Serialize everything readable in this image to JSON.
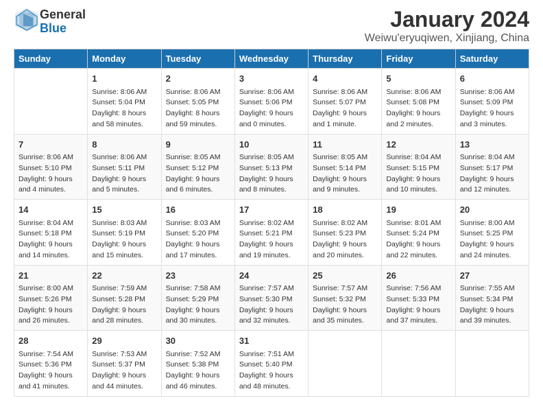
{
  "logo": {
    "general": "General",
    "blue": "Blue"
  },
  "title": "January 2024",
  "subtitle": "Weiwu'eryuqiwen, Xinjiang, China",
  "headers": [
    "Sunday",
    "Monday",
    "Tuesday",
    "Wednesday",
    "Thursday",
    "Friday",
    "Saturday"
  ],
  "weeks": [
    [
      {
        "day": "",
        "lines": []
      },
      {
        "day": "1",
        "lines": [
          "Sunrise: 8:06 AM",
          "Sunset: 5:04 PM",
          "Daylight: 8 hours",
          "and 58 minutes."
        ]
      },
      {
        "day": "2",
        "lines": [
          "Sunrise: 8:06 AM",
          "Sunset: 5:05 PM",
          "Daylight: 8 hours",
          "and 59 minutes."
        ]
      },
      {
        "day": "3",
        "lines": [
          "Sunrise: 8:06 AM",
          "Sunset: 5:06 PM",
          "Daylight: 9 hours",
          "and 0 minutes."
        ]
      },
      {
        "day": "4",
        "lines": [
          "Sunrise: 8:06 AM",
          "Sunset: 5:07 PM",
          "Daylight: 9 hours",
          "and 1 minute."
        ]
      },
      {
        "day": "5",
        "lines": [
          "Sunrise: 8:06 AM",
          "Sunset: 5:08 PM",
          "Daylight: 9 hours",
          "and 2 minutes."
        ]
      },
      {
        "day": "6",
        "lines": [
          "Sunrise: 8:06 AM",
          "Sunset: 5:09 PM",
          "Daylight: 9 hours",
          "and 3 minutes."
        ]
      }
    ],
    [
      {
        "day": "7",
        "lines": [
          "Sunrise: 8:06 AM",
          "Sunset: 5:10 PM",
          "Daylight: 9 hours",
          "and 4 minutes."
        ]
      },
      {
        "day": "8",
        "lines": [
          "Sunrise: 8:06 AM",
          "Sunset: 5:11 PM",
          "Daylight: 9 hours",
          "and 5 minutes."
        ]
      },
      {
        "day": "9",
        "lines": [
          "Sunrise: 8:05 AM",
          "Sunset: 5:12 PM",
          "Daylight: 9 hours",
          "and 6 minutes."
        ]
      },
      {
        "day": "10",
        "lines": [
          "Sunrise: 8:05 AM",
          "Sunset: 5:13 PM",
          "Daylight: 9 hours",
          "and 8 minutes."
        ]
      },
      {
        "day": "11",
        "lines": [
          "Sunrise: 8:05 AM",
          "Sunset: 5:14 PM",
          "Daylight: 9 hours",
          "and 9 minutes."
        ]
      },
      {
        "day": "12",
        "lines": [
          "Sunrise: 8:04 AM",
          "Sunset: 5:15 PM",
          "Daylight: 9 hours",
          "and 10 minutes."
        ]
      },
      {
        "day": "13",
        "lines": [
          "Sunrise: 8:04 AM",
          "Sunset: 5:17 PM",
          "Daylight: 9 hours",
          "and 12 minutes."
        ]
      }
    ],
    [
      {
        "day": "14",
        "lines": [
          "Sunrise: 8:04 AM",
          "Sunset: 5:18 PM",
          "Daylight: 9 hours",
          "and 14 minutes."
        ]
      },
      {
        "day": "15",
        "lines": [
          "Sunrise: 8:03 AM",
          "Sunset: 5:19 PM",
          "Daylight: 9 hours",
          "and 15 minutes."
        ]
      },
      {
        "day": "16",
        "lines": [
          "Sunrise: 8:03 AM",
          "Sunset: 5:20 PM",
          "Daylight: 9 hours",
          "and 17 minutes."
        ]
      },
      {
        "day": "17",
        "lines": [
          "Sunrise: 8:02 AM",
          "Sunset: 5:21 PM",
          "Daylight: 9 hours",
          "and 19 minutes."
        ]
      },
      {
        "day": "18",
        "lines": [
          "Sunrise: 8:02 AM",
          "Sunset: 5:23 PM",
          "Daylight: 9 hours",
          "and 20 minutes."
        ]
      },
      {
        "day": "19",
        "lines": [
          "Sunrise: 8:01 AM",
          "Sunset: 5:24 PM",
          "Daylight: 9 hours",
          "and 22 minutes."
        ]
      },
      {
        "day": "20",
        "lines": [
          "Sunrise: 8:00 AM",
          "Sunset: 5:25 PM",
          "Daylight: 9 hours",
          "and 24 minutes."
        ]
      }
    ],
    [
      {
        "day": "21",
        "lines": [
          "Sunrise: 8:00 AM",
          "Sunset: 5:26 PM",
          "Daylight: 9 hours",
          "and 26 minutes."
        ]
      },
      {
        "day": "22",
        "lines": [
          "Sunrise: 7:59 AM",
          "Sunset: 5:28 PM",
          "Daylight: 9 hours",
          "and 28 minutes."
        ]
      },
      {
        "day": "23",
        "lines": [
          "Sunrise: 7:58 AM",
          "Sunset: 5:29 PM",
          "Daylight: 9 hours",
          "and 30 minutes."
        ]
      },
      {
        "day": "24",
        "lines": [
          "Sunrise: 7:57 AM",
          "Sunset: 5:30 PM",
          "Daylight: 9 hours",
          "and 32 minutes."
        ]
      },
      {
        "day": "25",
        "lines": [
          "Sunrise: 7:57 AM",
          "Sunset: 5:32 PM",
          "Daylight: 9 hours",
          "and 35 minutes."
        ]
      },
      {
        "day": "26",
        "lines": [
          "Sunrise: 7:56 AM",
          "Sunset: 5:33 PM",
          "Daylight: 9 hours",
          "and 37 minutes."
        ]
      },
      {
        "day": "27",
        "lines": [
          "Sunrise: 7:55 AM",
          "Sunset: 5:34 PM",
          "Daylight: 9 hours",
          "and 39 minutes."
        ]
      }
    ],
    [
      {
        "day": "28",
        "lines": [
          "Sunrise: 7:54 AM",
          "Sunset: 5:36 PM",
          "Daylight: 9 hours",
          "and 41 minutes."
        ]
      },
      {
        "day": "29",
        "lines": [
          "Sunrise: 7:53 AM",
          "Sunset: 5:37 PM",
          "Daylight: 9 hours",
          "and 44 minutes."
        ]
      },
      {
        "day": "30",
        "lines": [
          "Sunrise: 7:52 AM",
          "Sunset: 5:38 PM",
          "Daylight: 9 hours",
          "and 46 minutes."
        ]
      },
      {
        "day": "31",
        "lines": [
          "Sunrise: 7:51 AM",
          "Sunset: 5:40 PM",
          "Daylight: 9 hours",
          "and 48 minutes."
        ]
      },
      {
        "day": "",
        "lines": []
      },
      {
        "day": "",
        "lines": []
      },
      {
        "day": "",
        "lines": []
      }
    ]
  ]
}
